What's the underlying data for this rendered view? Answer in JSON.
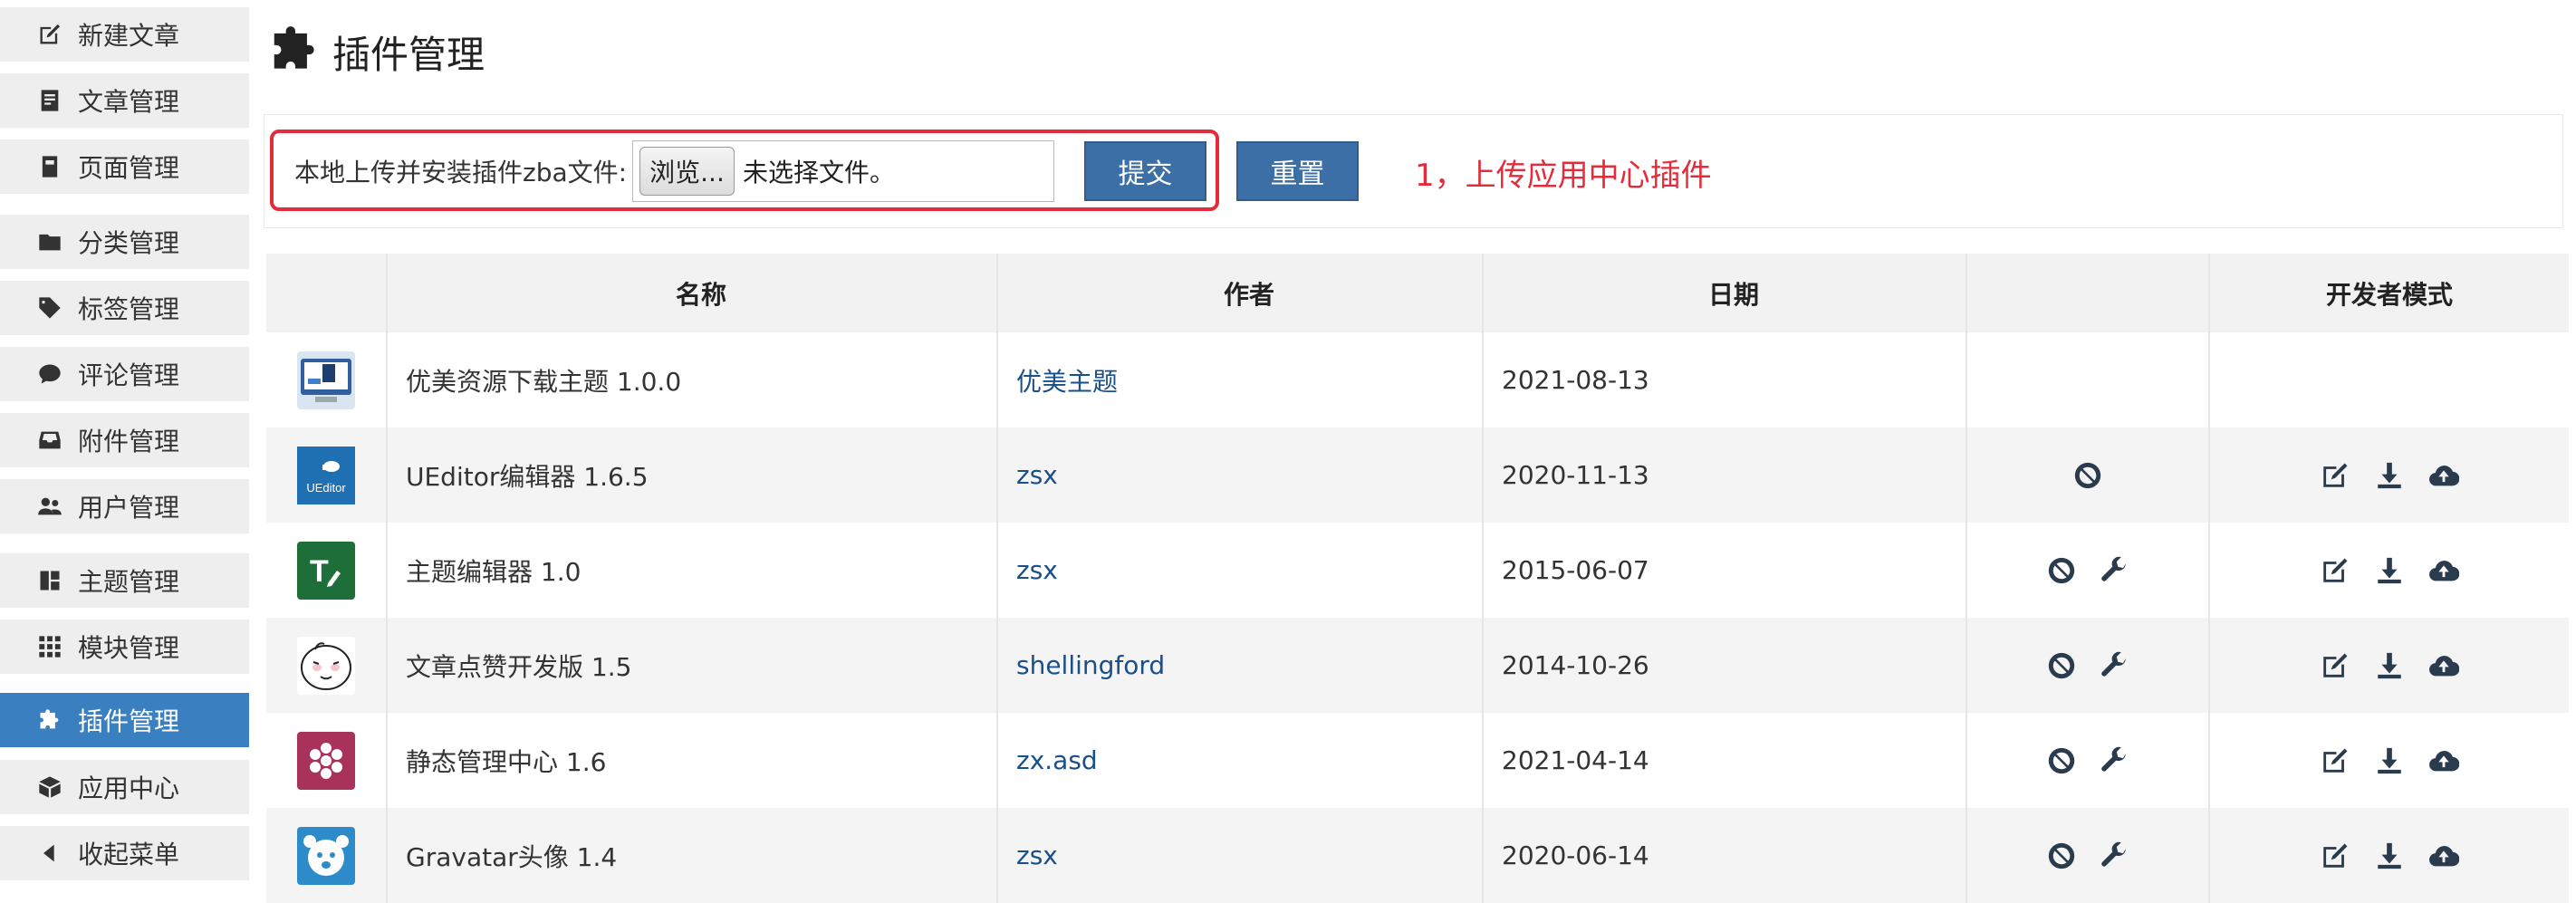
{
  "sidebar": {
    "items": [
      {
        "label": "新建文章",
        "icon": "edit-icon"
      },
      {
        "label": "文章管理",
        "icon": "document-icon"
      },
      {
        "label": "页面管理",
        "icon": "page-icon"
      },
      {
        "label": "分类管理",
        "icon": "folder-icon"
      },
      {
        "label": "标签管理",
        "icon": "tag-icon"
      },
      {
        "label": "评论管理",
        "icon": "comment-icon"
      },
      {
        "label": "附件管理",
        "icon": "inbox-icon"
      },
      {
        "label": "用户管理",
        "icon": "users-icon"
      },
      {
        "label": "主题管理",
        "icon": "layout-icon"
      },
      {
        "label": "模块管理",
        "icon": "grid-icon"
      },
      {
        "label": "插件管理",
        "icon": "puzzle-icon",
        "active": true
      },
      {
        "label": "应用中心",
        "icon": "box-icon"
      },
      {
        "label": "收起菜单",
        "icon": "caret-left-icon"
      }
    ]
  },
  "header": {
    "title": "插件管理",
    "icon": "puzzle-icon"
  },
  "upload": {
    "label": "本地上传并安装插件zba文件:",
    "browse_label": "浏览...",
    "file_status": "未选择文件。",
    "submit_label": "提交",
    "reset_label": "重置",
    "annotation": "1，上传应用中心插件",
    "highlight_color": "#e32d3c"
  },
  "table": {
    "headers": {
      "icon": "",
      "name": "名称",
      "author": "作者",
      "date": "日期",
      "actions": "",
      "dev": "开发者模式"
    },
    "rows": [
      {
        "name": "优美资源下载主题 1.0.0",
        "author": "优美主题",
        "date": "2021-08-13",
        "thumb": "download-theme-thumb",
        "actions": [],
        "dev": []
      },
      {
        "name": "UEditor编辑器 1.6.5",
        "author": "zsx",
        "date": "2020-11-13",
        "thumb": "ueditor-thumb",
        "thumb_text": "UEditor",
        "actions": [
          "disable-icon"
        ],
        "dev": [
          "edit-icon",
          "download-icon",
          "cloud-upload-icon"
        ]
      },
      {
        "name": "主题编辑器 1.0",
        "author": "zsx",
        "date": "2015-06-07",
        "thumb": "theme-editor-thumb",
        "actions": [
          "disable-icon",
          "wrench-icon"
        ],
        "dev": [
          "edit-icon",
          "download-icon",
          "cloud-upload-icon"
        ]
      },
      {
        "name": "文章点赞开发版 1.5",
        "author": "shellingford",
        "date": "2014-10-26",
        "thumb": "like-face-thumb",
        "actions": [
          "disable-icon",
          "wrench-icon"
        ],
        "dev": [
          "edit-icon",
          "download-icon",
          "cloud-upload-icon"
        ]
      },
      {
        "name": "静态管理中心 1.6",
        "author": "zx.asd",
        "date": "2021-04-14",
        "thumb": "static-manager-thumb",
        "actions": [
          "disable-icon",
          "wrench-icon"
        ],
        "dev": [
          "edit-icon",
          "download-icon",
          "cloud-upload-icon"
        ]
      },
      {
        "name": "Gravatar头像 1.4",
        "author": "zsx",
        "date": "2020-06-14",
        "thumb": "gravatar-thumb",
        "actions": [
          "disable-icon",
          "wrench-icon"
        ],
        "dev": [
          "edit-icon",
          "download-icon",
          "cloud-upload-icon"
        ]
      }
    ]
  },
  "colors": {
    "accent": "#3a7fbf",
    "button": "#3b6fa5",
    "link": "#1a4f8a",
    "annotation": "#e32d3c"
  }
}
